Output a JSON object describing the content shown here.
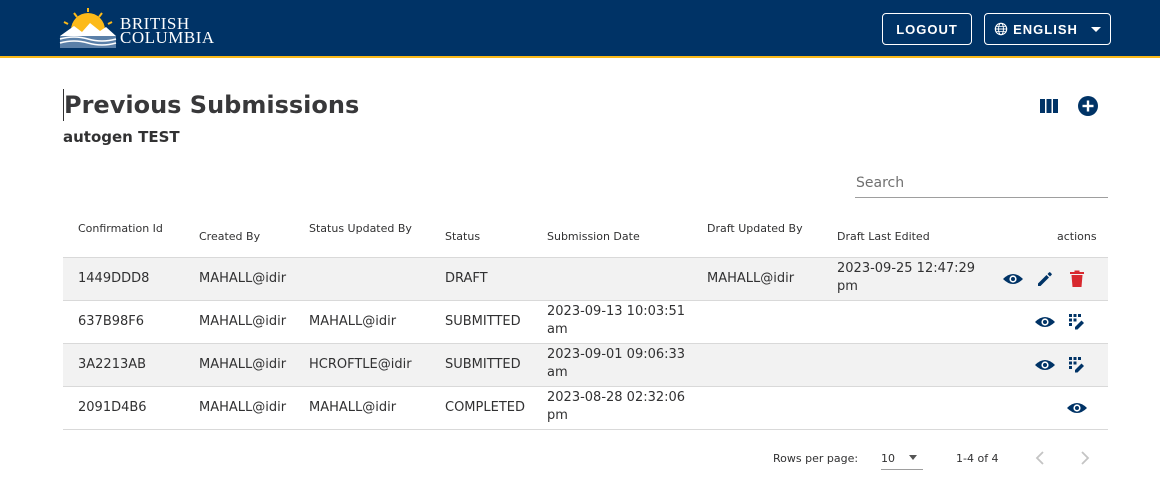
{
  "header": {
    "logo_line1": "BRITISH",
    "logo_line2": "COLUMBIA",
    "logout_label": "LOGOUT",
    "language_label": "ENGLISH"
  },
  "page": {
    "title": "Previous Submissions",
    "form_name": "autogen TEST"
  },
  "search": {
    "placeholder": "Search",
    "value": ""
  },
  "table": {
    "columns": [
      "Confirmation Id",
      "Created By",
      "Status Updated By",
      "Status",
      "Submission Date",
      "Draft Updated By",
      "Draft Last Edited",
      "actions"
    ],
    "rows": [
      {
        "id": "1449DDD8",
        "created_by": "MAHALL@idir",
        "status_updated_by": "",
        "status": "DRAFT",
        "submission_date": "",
        "draft_updated_by": "MAHALL@idir",
        "draft_last_edited": "2023-09-25 12:47:29 pm",
        "actions": [
          "eye-icon",
          "pencil-icon",
          "trash-icon"
        ]
      },
      {
        "id": "637B98F6",
        "created_by": "MAHALL@idir",
        "status_updated_by": "MAHALL@idir",
        "status": "SUBMITTED",
        "submission_date": "2023-09-13 10:03:51 am",
        "draft_updated_by": "",
        "draft_last_edited": "",
        "actions": [
          "eye-icon",
          "grid-edit-icon"
        ]
      },
      {
        "id": "3A2213AB",
        "created_by": "MAHALL@idir",
        "status_updated_by": "HCROFTLE@idir",
        "status": "SUBMITTED",
        "submission_date": "2023-09-01 09:06:33 am",
        "draft_updated_by": "",
        "draft_last_edited": "",
        "actions": [
          "eye-icon",
          "grid-edit-icon"
        ]
      },
      {
        "id": "2091D4B6",
        "created_by": "MAHALL@idir",
        "status_updated_by": "MAHALL@idir",
        "status": "COMPLETED",
        "submission_date": "2023-08-28 02:32:06 pm",
        "draft_updated_by": "",
        "draft_last_edited": "",
        "actions": [
          "eye-icon"
        ]
      }
    ]
  },
  "pagination": {
    "rows_per_page_label": "Rows per page:",
    "rows_per_page_value": "10",
    "range_text": "1-4 of 4"
  },
  "colors": {
    "header_bg": "#003366",
    "header_accent": "#fcba19",
    "icon_primary": "#003366",
    "icon_danger": "#d8292f",
    "row_shade": "#f2f2f2"
  }
}
